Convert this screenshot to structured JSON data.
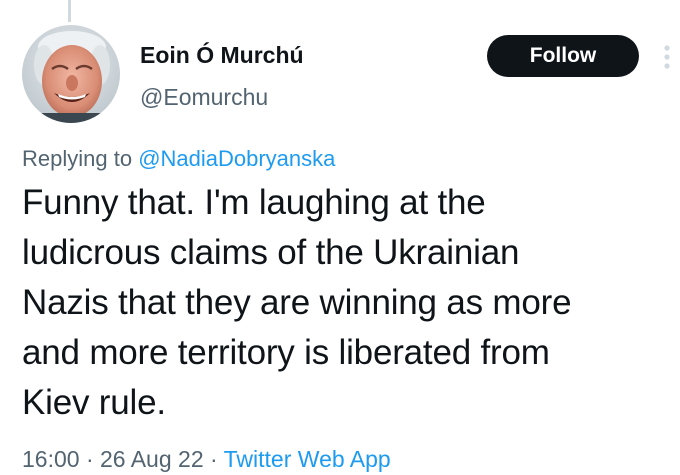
{
  "tweet": {
    "author": {
      "display_name": "Eoin Ó Murchú",
      "handle": "@Eomurchu"
    },
    "follow_label": "Follow",
    "replying_to_prefix": "Replying to ",
    "replying_to_handle": "@NadiaDobryanska",
    "text_lines": [
      "Funny that. I'm laughing at the",
      "ludicrous claims of the Ukrainian",
      "Nazis that they are winning as more",
      "and more territory is liberated from",
      "Kiev rule."
    ],
    "time": "16:00",
    "separator": " · ",
    "date": "26 Aug 22",
    "source": "Twitter Web App"
  },
  "icons": {
    "more": "more-vertical-icon"
  },
  "colors": {
    "text": "#0f1419",
    "secondary": "#536471",
    "link": "#1d9bf0",
    "button_bg": "#0f1419"
  }
}
